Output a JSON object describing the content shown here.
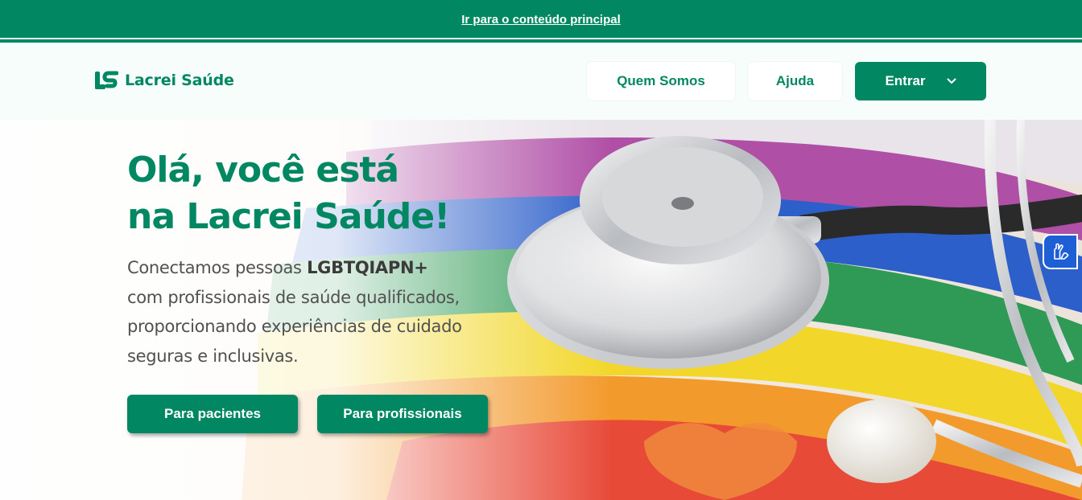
{
  "skip_link": {
    "label": "Ir para o conteúdo principal"
  },
  "header": {
    "logo_text": "Lacrei Saúde",
    "logo_icon": "lacrei-logo-icon",
    "nav": {
      "about_label": "Quem Somos",
      "help_label": "Ajuda",
      "login_label": "Entrar",
      "login_icon": "chevron-down-icon"
    }
  },
  "hero": {
    "title_line1": "Olá, você está",
    "title_line2": "na Lacrei Saúde!",
    "description_prefix": "Conectamos pessoas",
    "description_highlight": "LGBTQIAPN+",
    "description_line2": "com profissionais de saúde qualificados,",
    "description_line3": "proporcionando experiências de cuidado",
    "description_line4": "seguras e inclusivas.",
    "patients_button": "Para pacientes",
    "professionals_button": "Para profissionais",
    "image": "stethoscope-on-rainbow-flag-image"
  },
  "accessibility_widget": {
    "icon": "sign-language-hands-icon"
  },
  "colors": {
    "brand_green": "#018762",
    "text_gray": "#515151",
    "widget_blue": "#1f5fd6",
    "header_bg": "#f7fdfb"
  }
}
